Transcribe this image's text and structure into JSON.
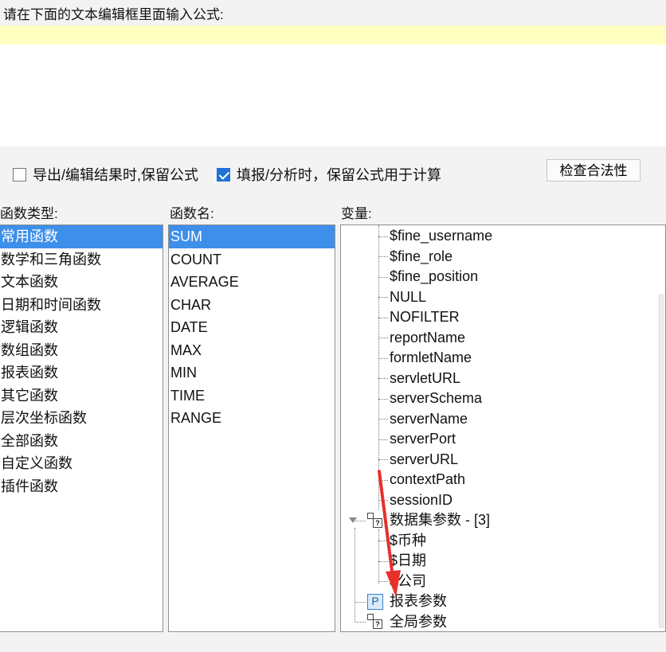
{
  "prompt_label": "请在下面的文本编辑框里面输入公式:",
  "editor": {
    "value": ""
  },
  "options": {
    "keep_formula_export": {
      "label": "导出/编辑结果时,保留公式",
      "checked": false
    },
    "keep_formula_fill": {
      "label": "填报/分析时，保留公式用于计算",
      "checked": true
    }
  },
  "check_button": {
    "label": "检查合法性"
  },
  "function_types": {
    "label": "函数类型:",
    "selected": 0,
    "items": [
      "常用函数",
      "数学和三角函数",
      "文本函数",
      "日期和时间函数",
      "逻辑函数",
      "数组函数",
      "报表函数",
      "其它函数",
      "层次坐标函数",
      "全部函数",
      "自定义函数",
      "插件函数"
    ]
  },
  "function_names": {
    "label": "函数名:",
    "selected": 0,
    "items": [
      "SUM",
      "COUNT",
      "AVERAGE",
      "CHAR",
      "DATE",
      "MAX",
      "MIN",
      "TIME",
      "RANGE"
    ]
  },
  "variables": {
    "label": "变量:",
    "builtin_items": [
      "$fine_username",
      "$fine_role",
      "$fine_position",
      "NULL",
      "NOFILTER",
      "reportName",
      "formletName",
      "servletURL",
      "serverSchema",
      "serverName",
      "serverPort",
      "serverURL",
      "contextPath",
      "sessionID"
    ],
    "dataset_group": {
      "label": "数据集参数 - [3]",
      "items": [
        "$币种",
        "$日期",
        "$公司"
      ]
    },
    "report_params": {
      "label": "报表参数",
      "icon_letter": "P"
    },
    "global_params": {
      "label": "全局参数"
    },
    "dataset_icon_letter": "?"
  },
  "colors": {
    "selection": "#3d8fea",
    "editor_highlight": "#ffffc2",
    "annotation_arrow": "#e8302a",
    "checkbox_checked": "#1f72d6"
  }
}
